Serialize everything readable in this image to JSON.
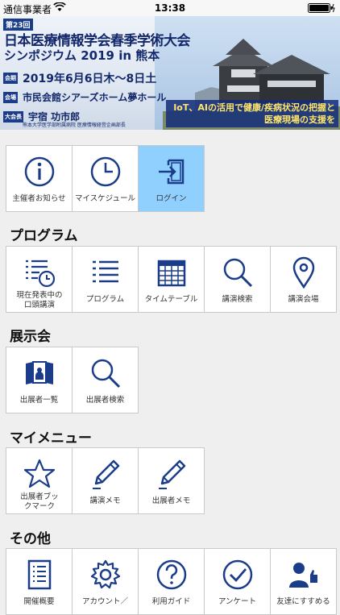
{
  "status_bar": {
    "carrier": "通信事業者",
    "time": "13:38"
  },
  "banner": {
    "edition": "第23回",
    "title1": "日本医療情報学会春季学術大会",
    "title2": "シンポジウム 2019 in 熊本",
    "period_tag": "会期",
    "period": "2019年6月6日木～8日土",
    "venue_tag": "会場",
    "venue": "市民会館シアーズホーム夢ホール",
    "chair_tag": "大会長",
    "chair": "宇宿 功市郎",
    "chair_affil": "熊本大学医学部附属病院 医療情報経営企画部長",
    "tagline": "IoT、AIの活用で健康/疾病状況の把握と医療現場の支援を"
  },
  "top_tiles": [
    {
      "label": "主催者お知らせ"
    },
    {
      "label": "マイスケジュール"
    },
    {
      "label": "ログイン"
    }
  ],
  "sections": {
    "program": {
      "title": "プログラム",
      "tiles": [
        {
          "label": "現在発表中の口頭講演"
        },
        {
          "label": "プログラム"
        },
        {
          "label": "タイムテーブル"
        },
        {
          "label": "講演検索"
        },
        {
          "label": "講演会場"
        }
      ]
    },
    "exhibit": {
      "title": "展示会",
      "tiles": [
        {
          "label": "出展者一覧"
        },
        {
          "label": "出展者検索"
        }
      ]
    },
    "mymenu": {
      "title": "マイメニュー",
      "tiles": [
        {
          "label": "出展者ブックマーク"
        },
        {
          "label": "講演メモ"
        },
        {
          "label": "出展者メモ"
        }
      ]
    },
    "other": {
      "title": "その他",
      "tiles": [
        {
          "label": "開催概要"
        },
        {
          "label": "アカウント／"
        },
        {
          "label": "利用ガイド"
        },
        {
          "label": "アンケート"
        },
        {
          "label": "友達にすすめる"
        }
      ]
    }
  },
  "colors": {
    "accent": "#1b3d89",
    "active_tile": "#8fd0ff",
    "background": "#efefef"
  }
}
